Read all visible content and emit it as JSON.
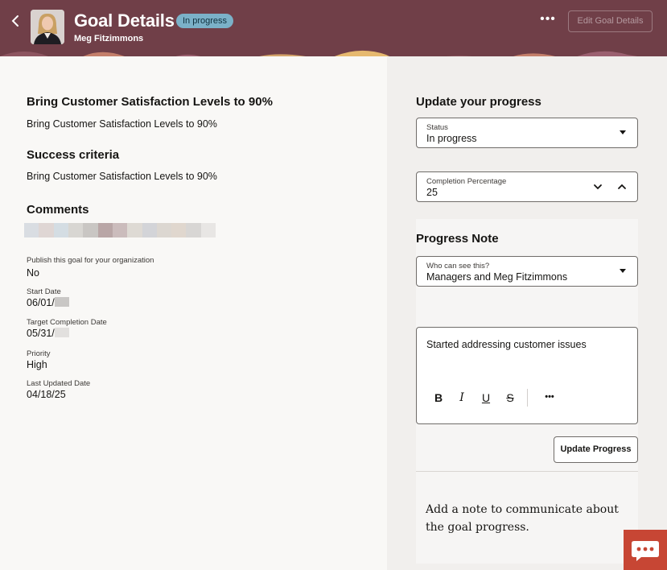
{
  "header": {
    "title": "Goal Details",
    "status_badge": "In progress",
    "subtitle": "Meg Fitzimmons",
    "more_label": "•••",
    "edit_button": "Edit Goal Details",
    "accent_color": "#703f48"
  },
  "goal": {
    "title": "Bring Customer Satisfaction Levels to 90%",
    "description": "Bring Customer Satisfaction Levels to 90%",
    "success_heading": "Success criteria",
    "success_text": "Bring Customer Satisfaction Levels to 90%",
    "comments_heading": "Comments"
  },
  "details": {
    "publish_label": "Publish this goal for your organization",
    "publish_value": "No",
    "start_label": "Start Date",
    "start_value": "06/01/",
    "target_label": "Target Completion Date",
    "target_value": "05/31/",
    "priority_label": "Priority",
    "priority_value": "High",
    "updated_label": "Last Updated Date",
    "updated_value": "04/18/25"
  },
  "progress": {
    "heading": "Update your progress",
    "status_label": "Status",
    "status_value": "In progress",
    "completion_label": "Completion Percentage",
    "completion_value": "25"
  },
  "note": {
    "heading": "Progress Note",
    "visibility_label": "Who can see this?",
    "visibility_value": "Managers and Meg Fitzimmons",
    "editor_text": "Started addressing customer issues",
    "toolbar": {
      "bold": "B",
      "italic": "I",
      "underline": "U",
      "strike": "S",
      "more": "•••"
    },
    "update_button": "Update Progress",
    "hint": "Add a note to communicate about the goal progress."
  }
}
